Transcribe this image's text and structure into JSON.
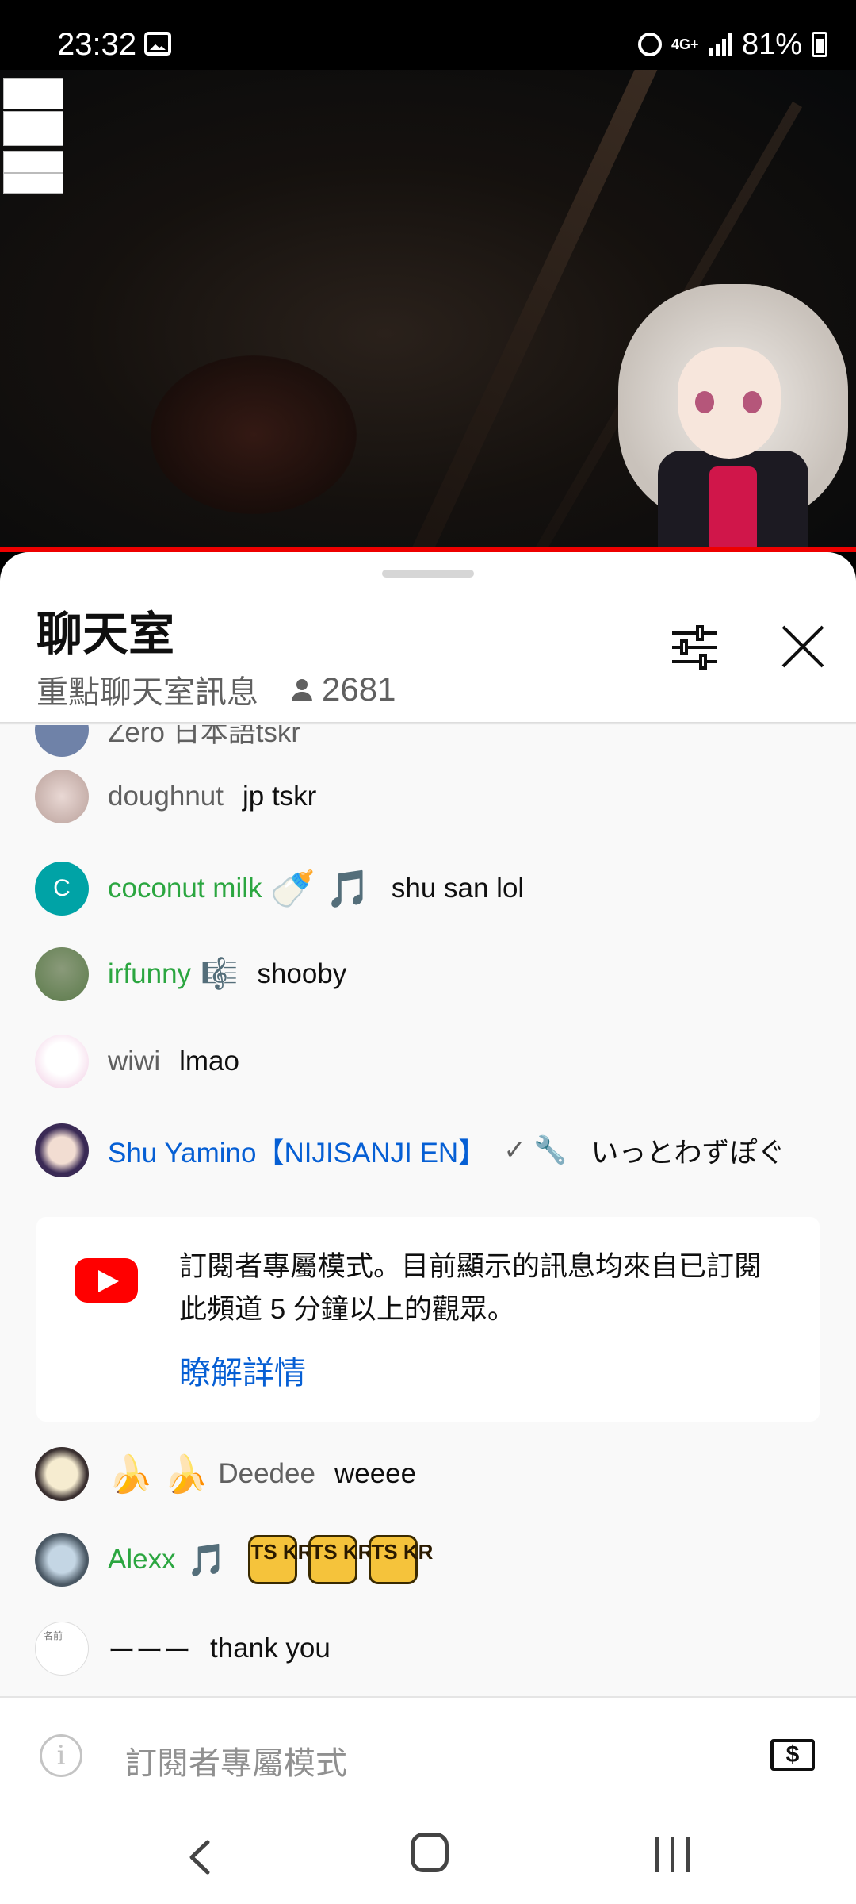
{
  "status_bar": {
    "time": "23:32",
    "network": "4G+",
    "battery": "81%"
  },
  "chat_panel": {
    "title": "聊天室",
    "subtitle": "重點聊天室訊息",
    "viewer_count": "2681",
    "partial_message": "Zero 日本語tskr"
  },
  "messages": [
    {
      "author": "doughnut",
      "text": "jp tskr",
      "author_type": "normal",
      "avatar_color": "#c9b3b0"
    },
    {
      "author": "coconut milk",
      "badges": "🍼 🎵",
      "text": "shu san lol",
      "author_type": "member",
      "avatar_letter": "C",
      "avatar_color": "#00a3a6"
    },
    {
      "author": "irfunny",
      "badges": "🎼",
      "text": "shooby",
      "author_type": "member",
      "avatar_color": "#7c9c6a"
    },
    {
      "author": "wiwi",
      "text": "lmao",
      "author_type": "normal",
      "avatar_color": "#f3d9ea"
    },
    {
      "author": "Shu Yamino【NIJISANJI EN】",
      "badges": "✓ 🔧",
      "text": "いっとわずぽぐ",
      "author_type": "owner",
      "avatar_color": "#4a3a6a"
    },
    {
      "author": "Deedee",
      "prefix_badges": "🍌 🍌",
      "text": "weeee",
      "author_type": "normal",
      "avatar_color": "#f0e4c0"
    },
    {
      "author": "Alexx",
      "badges": "🎵",
      "text": "",
      "emotes": [
        "TS KR",
        "TS KR",
        "TS KR"
      ],
      "author_type": "member",
      "avatar_color": "#5a6d7a"
    },
    {
      "author": "ーーー",
      "text": "thank you",
      "author_type": "normal",
      "avatar_label": "名前",
      "avatar_color": "#ffffff"
    }
  ],
  "notice": {
    "text": "訂閱者專屬模式。目前顯示的訊息均來自已訂閱此頻道 5 分鐘以上的觀眾。",
    "link": "瞭解詳情"
  },
  "footer": {
    "placeholder": "訂閱者專屬模式",
    "info_icon_glyph": "i",
    "dollar_glyph": "$"
  },
  "colors": {
    "member": "#2ba640",
    "owner": "#065fd4",
    "normal": "#606060",
    "progress": "#ff0000"
  }
}
